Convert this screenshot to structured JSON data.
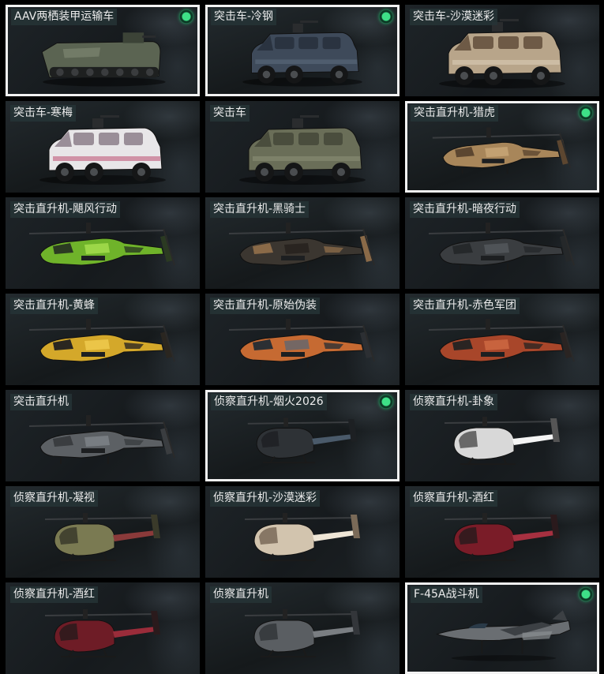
{
  "vehicles": [
    {
      "name": "AAV两栖装甲运输车",
      "type": "amphibious",
      "selected": true,
      "equipped": true,
      "scheme": [
        "#5b6452",
        "#3c4337",
        "#7c8570"
      ]
    },
    {
      "name": "突击车-冷钢",
      "type": "truck",
      "selected": true,
      "equipped": true,
      "scheme": [
        "#3e4a5a",
        "#2a3340",
        "#5c6a7c"
      ]
    },
    {
      "name": "突击车-沙漠迷彩",
      "type": "truck",
      "selected": false,
      "equipped": false,
      "scheme": [
        "#b8a58a",
        "#6e5a46",
        "#d8cbb6"
      ]
    },
    {
      "name": "突击车-寒梅",
      "type": "truck",
      "selected": false,
      "equipped": false,
      "scheme": [
        "#e8e6e8",
        "#9a8e98",
        "#c05a7a"
      ]
    },
    {
      "name": "突击车",
      "type": "truck",
      "selected": false,
      "equipped": false,
      "scheme": [
        "#6a6e58",
        "#4a4d3d",
        "#8a8e74"
      ]
    },
    {
      "name": "突击直升机-猎虎",
      "type": "attack-heli",
      "selected": true,
      "equipped": true,
      "scheme": [
        "#a8865a",
        "#5c4630",
        "#c9a878"
      ]
    },
    {
      "name": "突击直升机-飓风行动",
      "type": "attack-heli",
      "selected": false,
      "equipped": false,
      "scheme": [
        "#6fb32a",
        "#2b3a22",
        "#a8e050"
      ]
    },
    {
      "name": "突击直升机-黑骑士",
      "type": "attack-heli",
      "selected": false,
      "equipped": false,
      "scheme": [
        "#3b3630",
        "#8a6a48",
        "#25211d"
      ]
    },
    {
      "name": "突击直升机-暗夜行动",
      "type": "attack-heli",
      "selected": false,
      "equipped": false,
      "scheme": [
        "#3a3d40",
        "#25282a",
        "#55595c"
      ]
    },
    {
      "name": "突击直升机-黄蜂",
      "type": "attack-heli",
      "selected": false,
      "equipped": false,
      "scheme": [
        "#d4a82a",
        "#2a2620",
        "#f0cc50"
      ]
    },
    {
      "name": "突击直升机-原始伪装",
      "type": "attack-heli",
      "selected": false,
      "equipped": false,
      "scheme": [
        "#c66a32",
        "#2c2f33",
        "#5f6670"
      ]
    },
    {
      "name": "突击直升机-赤色军团",
      "type": "attack-heli",
      "selected": false,
      "equipped": false,
      "scheme": [
        "#a8462a",
        "#2a2422",
        "#d06a44"
      ]
    },
    {
      "name": "突击直升机",
      "type": "attack-heli",
      "selected": false,
      "equipped": false,
      "scheme": [
        "#5c6064",
        "#3a3d40",
        "#80858a"
      ]
    },
    {
      "name": "侦察直升机-烟火2026",
      "type": "scout-heli",
      "selected": true,
      "equipped": true,
      "scheme": [
        "#2e3236",
        "#1d2023",
        "#4a5a6a"
      ]
    },
    {
      "name": "侦察直升机-卦象",
      "type": "scout-heli",
      "selected": false,
      "equipped": false,
      "scheme": [
        "#d8d8d8",
        "#555555",
        "#f4f4f4"
      ]
    },
    {
      "name": "侦察直升机-凝视",
      "type": "scout-heli",
      "selected": false,
      "equipped": false,
      "scheme": [
        "#7a7a52",
        "#3a3a2a",
        "#8a3a3a"
      ]
    },
    {
      "name": "侦察直升机-沙漠迷彩",
      "type": "scout-heli",
      "selected": false,
      "equipped": false,
      "scheme": [
        "#d2c4ae",
        "#7a6a58",
        "#efe6d6"
      ]
    },
    {
      "name": "侦察直升机-酒红",
      "type": "scout-heli",
      "selected": false,
      "equipped": false,
      "scheme": [
        "#7a1c28",
        "#2a1a1c",
        "#a63040"
      ]
    },
    {
      "name": "侦察直升机-酒红",
      "type": "scout-heli",
      "selected": false,
      "equipped": false,
      "scheme": [
        "#6e1c26",
        "#2a1a1c",
        "#9a2c3a"
      ]
    },
    {
      "name": "侦察直升机",
      "type": "scout-heli",
      "selected": false,
      "equipped": false,
      "scheme": [
        "#5a5e62",
        "#33363a",
        "#7a7e82"
      ]
    },
    {
      "name": "F-45A战斗机",
      "type": "jet",
      "selected": true,
      "equipped": true,
      "scheme": [
        "#6a6e72",
        "#3c4044",
        "#8a8e92"
      ]
    }
  ]
}
